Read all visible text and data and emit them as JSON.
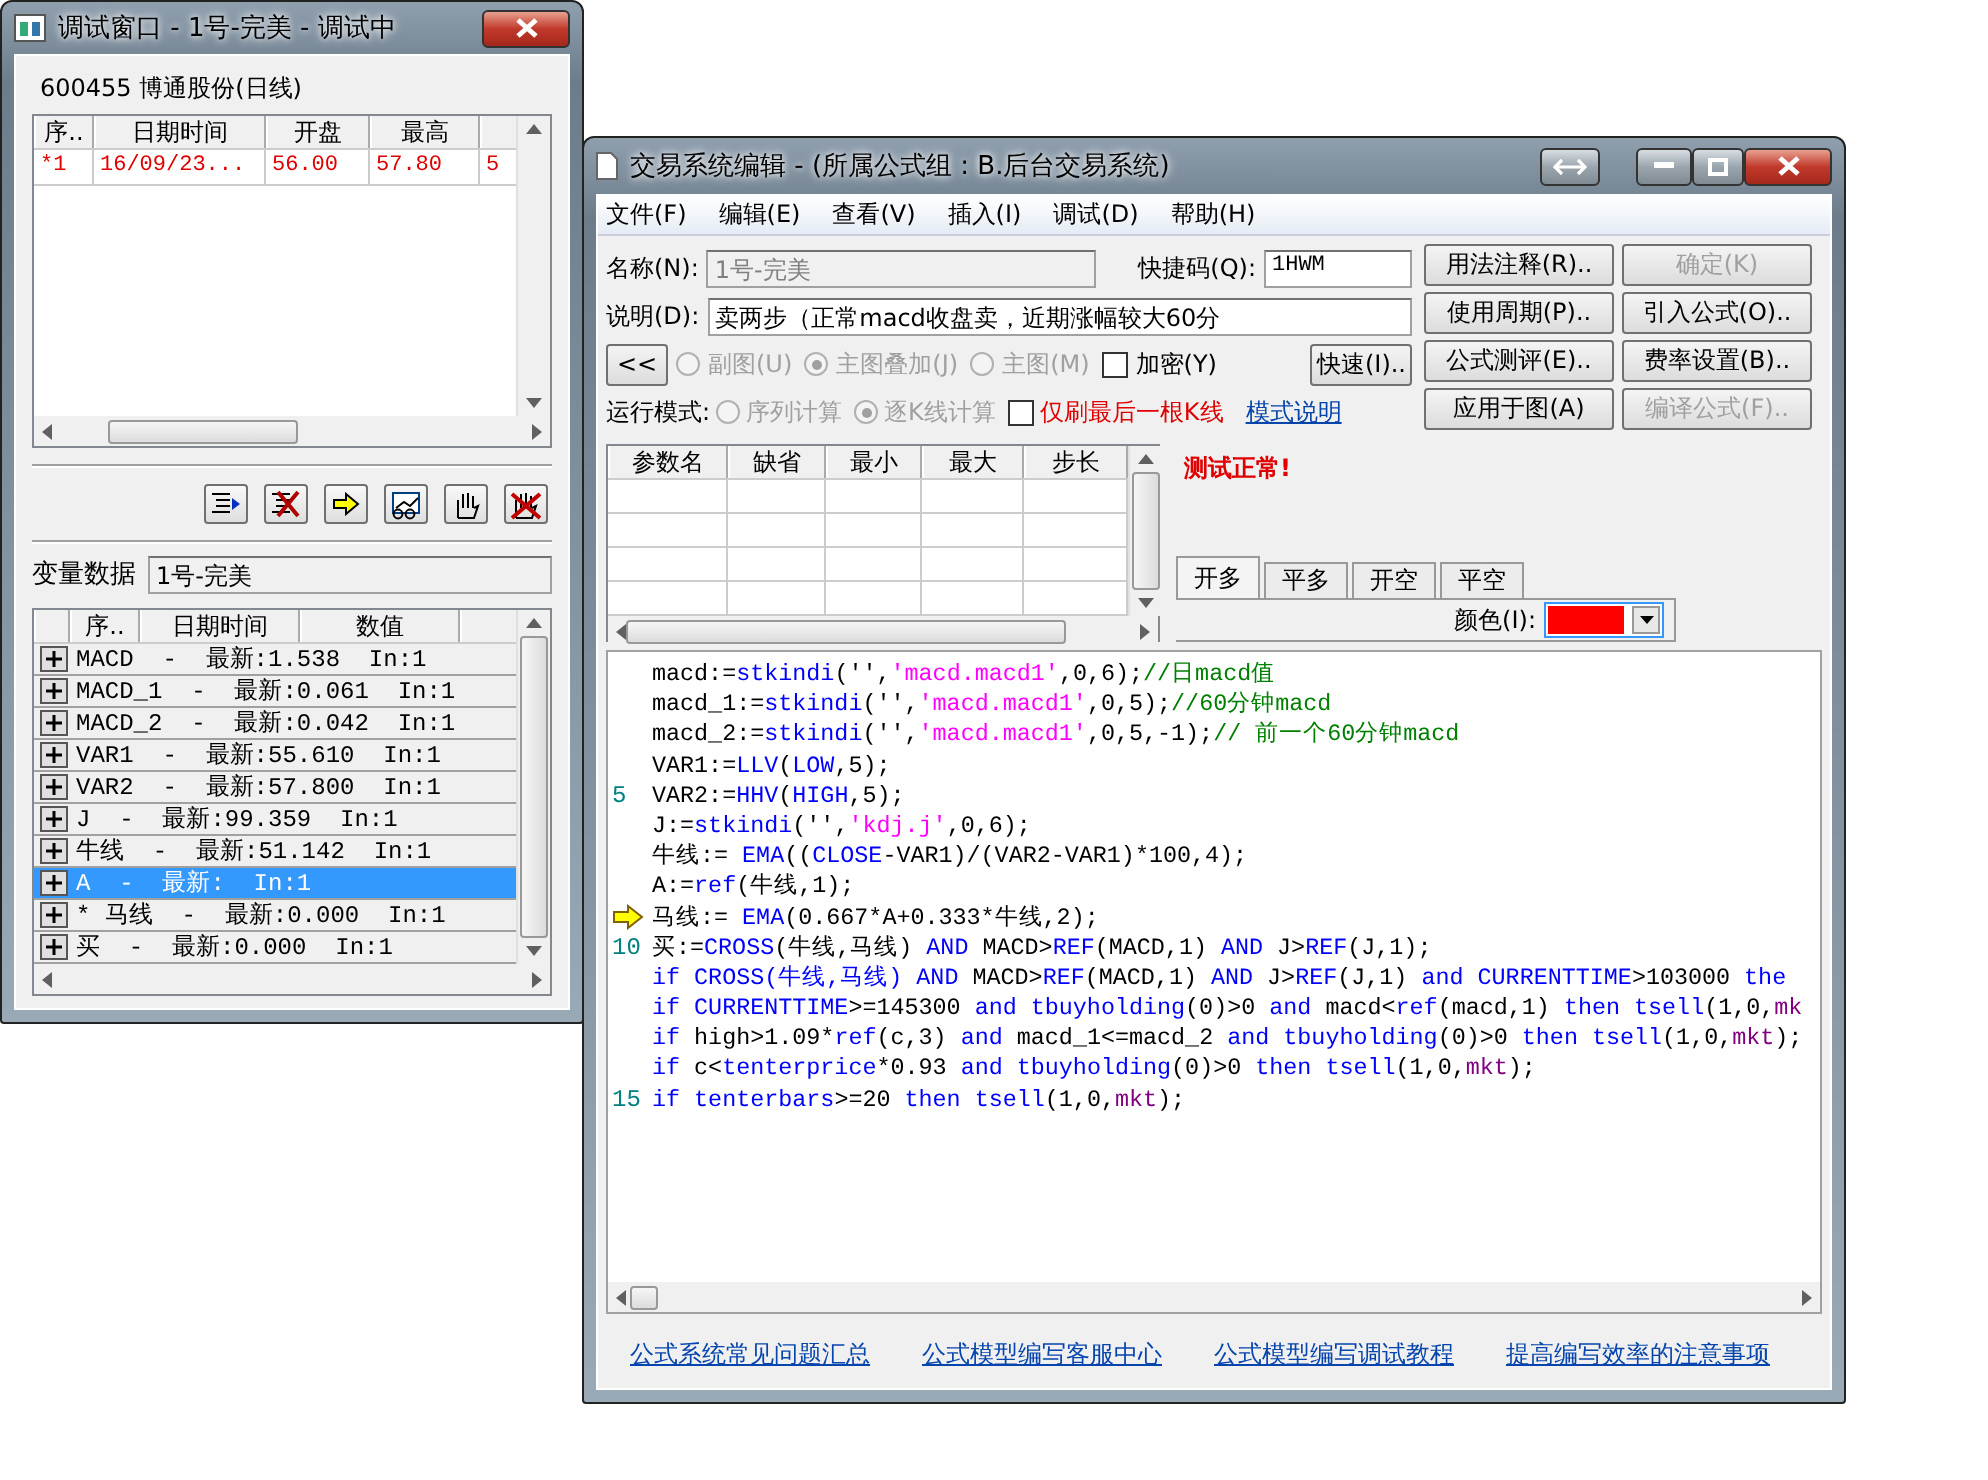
{
  "debug_window": {
    "title": "调试窗口 - 1号-完美 - 调试中",
    "stock": "600455 博通股份(日线)",
    "quote_table": {
      "columns": [
        "序..",
        "日期时间",
        "开盘",
        "最高"
      ],
      "rows": [
        {
          "cells": [
            "*1",
            "16/09/23...",
            "56.00",
            "57.80",
            "5"
          ]
        }
      ]
    },
    "variable_label": "变量数据",
    "variable_value": "1号-完美",
    "variable_table": {
      "columns": [
        "序..",
        "日期时间",
        "数值"
      ],
      "rows": [
        {
          "text": "MACD  -  最新:1.538  In:1",
          "selected": false
        },
        {
          "text": "MACD_1  -  最新:0.061  In:1",
          "selected": false
        },
        {
          "text": "MACD_2  -  最新:0.042  In:1",
          "selected": false
        },
        {
          "text": "VAR1  -  最新:55.610  In:1",
          "selected": false
        },
        {
          "text": "VAR2  -  最新:57.800  In:1",
          "selected": false
        },
        {
          "text": "J  -  最新:99.359  In:1",
          "selected": false
        },
        {
          "text": "牛线  -  最新:51.142  In:1",
          "selected": false
        },
        {
          "text": "A  -  最新:  In:1",
          "selected": true
        },
        {
          "text": "* 马线  -  最新:0.000  In:1",
          "selected": false
        },
        {
          "text": "买  -  最新:0.000  In:1",
          "selected": false
        }
      ]
    }
  },
  "editor_window": {
    "title": "交易系统编辑 - (所属公式组 : B.后台交易系统)",
    "menu": [
      "文件(F)",
      "编辑(E)",
      "查看(V)",
      "插入(I)",
      "调试(D)",
      "帮助(H)"
    ],
    "name": {
      "label": "名称(N):",
      "value": "1号-完美"
    },
    "shortcut": {
      "label": "快捷码(Q):",
      "value": "1HWM"
    },
    "description": {
      "label": "说明(D):",
      "value": "卖两步（正常macd收盘卖，近期涨幅较大60分"
    },
    "buttons": [
      {
        "label": "用法注释(R)..",
        "disabled": false
      },
      {
        "label": "确定(K)",
        "disabled": true
      },
      {
        "label": "使用周期(P)..",
        "disabled": false
      },
      {
        "label": "引入公式(O)..",
        "disabled": false
      },
      {
        "label": "公式测评(E)..",
        "disabled": false
      },
      {
        "label": "费率设置(B)..",
        "disabled": false
      },
      {
        "label": "应用于图(A)",
        "disabled": false
      },
      {
        "label": "编译公式(F)..",
        "disabled": true
      }
    ],
    "collapse_button": "<<",
    "chart_modes": [
      {
        "label": "副图(U)",
        "selected": false,
        "disabled": true
      },
      {
        "label": "主图叠加(J)",
        "selected": true,
        "disabled": true
      },
      {
        "label": "主图(M)",
        "selected": false,
        "disabled": true
      }
    ],
    "encrypt": {
      "label": "加密(Y)",
      "checked": false
    },
    "quick_button": "快速(I)..",
    "run_mode": {
      "label": "运行模式:",
      "options": [
        {
          "label": "序列计算",
          "selected": false,
          "disabled": true
        },
        {
          "label": "逐K线计算",
          "selected": true,
          "disabled": true
        }
      ]
    },
    "last_bar_only": {
      "label": "仅刷最后一根K线",
      "checked": false
    },
    "mode_link": "模式说明",
    "param_table": {
      "columns": [
        "参数名",
        "缺省",
        "最小",
        "最大",
        "步长"
      ]
    },
    "status": "测试正常!",
    "tabs": [
      {
        "label": "开多",
        "selected": true
      },
      {
        "label": "平多",
        "selected": false
      },
      {
        "label": "开空",
        "selected": false
      },
      {
        "label": "平空",
        "selected": false
      }
    ],
    "color": {
      "label": "颜色(I):",
      "color": "#ff0000"
    },
    "code_lines": [
      {
        "current": false,
        "segments": [
          {
            "kind": "text",
            "text": "macd:="
          },
          {
            "kind": "func",
            "text": "stkindi"
          },
          {
            "kind": "text",
            "text": "('',"
          },
          {
            "kind": "string",
            "text": "'macd.macd1'"
          },
          {
            "kind": "text",
            "text": ",0,6);"
          },
          {
            "kind": "comment",
            "text": "//日macd值"
          }
        ]
      },
      {
        "current": false,
        "segments": [
          {
            "kind": "text",
            "text": "macd_1:="
          },
          {
            "kind": "func",
            "text": "stkindi"
          },
          {
            "kind": "text",
            "text": "('',"
          },
          {
            "kind": "string",
            "text": "'macd.macd1'"
          },
          {
            "kind": "text",
            "text": ",0,5);"
          },
          {
            "kind": "comment",
            "text": "//60分钟macd"
          }
        ]
      },
      {
        "current": false,
        "segments": [
          {
            "kind": "text",
            "text": "macd_2:="
          },
          {
            "kind": "func",
            "text": "stkindi"
          },
          {
            "kind": "text",
            "text": "('',"
          },
          {
            "kind": "string",
            "text": "'macd.macd1'"
          },
          {
            "kind": "text",
            "text": ",0,5,-1);"
          },
          {
            "kind": "comment",
            "text": "// 前一个60分钟macd"
          }
        ]
      },
      {
        "current": false,
        "segments": [
          {
            "kind": "text",
            "text": "VAR1:="
          },
          {
            "kind": "func",
            "text": "LLV"
          },
          {
            "kind": "text",
            "text": "("
          },
          {
            "kind": "func",
            "text": "LOW"
          },
          {
            "kind": "text",
            "text": ",5);"
          }
        ]
      },
      {
        "number": "5",
        "current": false,
        "segments": [
          {
            "kind": "text",
            "text": "VAR2:="
          },
          {
            "kind": "func",
            "text": "HHV"
          },
          {
            "kind": "text",
            "text": "("
          },
          {
            "kind": "func",
            "text": "HIGH"
          },
          {
            "kind": "text",
            "text": ",5);"
          }
        ]
      },
      {
        "current": false,
        "segments": [
          {
            "kind": "text",
            "text": "J:="
          },
          {
            "kind": "func",
            "text": "stkindi"
          },
          {
            "kind": "text",
            "text": "('',"
          },
          {
            "kind": "string",
            "text": "'kdj.j'"
          },
          {
            "kind": "text",
            "text": ",0,6);"
          }
        ]
      },
      {
        "current": false,
        "segments": [
          {
            "kind": "text",
            "text": "牛线:= "
          },
          {
            "kind": "func",
            "text": "EMA"
          },
          {
            "kind": "text",
            "text": "(("
          },
          {
            "kind": "func",
            "text": "CLOSE"
          },
          {
            "kind": "text",
            "text": "-VAR1)/(VAR2-VAR1)*100,4);"
          }
        ]
      },
      {
        "current": false,
        "segments": [
          {
            "kind": "text",
            "text": "A:="
          },
          {
            "kind": "func",
            "text": "ref"
          },
          {
            "kind": "text",
            "text": "(牛线,1);"
          }
        ]
      },
      {
        "current": true,
        "segments": [
          {
            "kind": "text",
            "text": "马线:= "
          },
          {
            "kind": "func",
            "text": "EMA"
          },
          {
            "kind": "text",
            "text": "(0.667*A+0.333*牛线,2);"
          }
        ]
      },
      {
        "number": "10",
        "current": false,
        "segments": [
          {
            "kind": "text",
            "text": "买:="
          },
          {
            "kind": "func",
            "text": "CROSS"
          },
          {
            "kind": "text",
            "text": "(牛线,马线) "
          },
          {
            "kind": "func",
            "text": "AND"
          },
          {
            "kind": "text",
            "text": " MACD>"
          },
          {
            "kind": "func",
            "text": "REF"
          },
          {
            "kind": "text",
            "text": "(MACD,1) "
          },
          {
            "kind": "func",
            "text": "AND"
          },
          {
            "kind": "text",
            "text": " J>"
          },
          {
            "kind": "func",
            "text": "REF"
          },
          {
            "kind": "text",
            "text": "(J,1);"
          }
        ]
      },
      {
        "current": false,
        "segments": [
          {
            "kind": "func",
            "text": "if CROSS(牛线,马线) AND"
          },
          {
            "kind": "text",
            "text": " MACD>"
          },
          {
            "kind": "func",
            "text": "REF"
          },
          {
            "kind": "text",
            "text": "(MACD,1) "
          },
          {
            "kind": "func",
            "text": "AND"
          },
          {
            "kind": "text",
            "text": " J>"
          },
          {
            "kind": "func",
            "text": "REF"
          },
          {
            "kind": "text",
            "text": "(J,1) "
          },
          {
            "kind": "func",
            "text": "and CURRENTTIME"
          },
          {
            "kind": "text",
            "text": ">103000 "
          },
          {
            "kind": "func",
            "text": "the"
          }
        ]
      },
      {
        "current": false,
        "segments": [
          {
            "kind": "func",
            "text": "if CURRENTTIME"
          },
          {
            "kind": "text",
            "text": ">=145300 "
          },
          {
            "kind": "func",
            "text": "and tbuyholding"
          },
          {
            "kind": "text",
            "text": "(0)>0 "
          },
          {
            "kind": "func",
            "text": "and"
          },
          {
            "kind": "text",
            "text": " macd<"
          },
          {
            "kind": "func",
            "text": "ref"
          },
          {
            "kind": "text",
            "text": "(macd,1) "
          },
          {
            "kind": "func",
            "text": "then tsell"
          },
          {
            "kind": "text",
            "text": "(1,0,"
          },
          {
            "kind": "const",
            "text": "mk"
          }
        ]
      },
      {
        "current": false,
        "segments": [
          {
            "kind": "func",
            "text": "if"
          },
          {
            "kind": "text",
            "text": " high>1.09*"
          },
          {
            "kind": "func",
            "text": "ref"
          },
          {
            "kind": "text",
            "text": "(c,3) "
          },
          {
            "kind": "func",
            "text": "and"
          },
          {
            "kind": "text",
            "text": " macd_1<=macd_2 "
          },
          {
            "kind": "func",
            "text": "and tbuyholding"
          },
          {
            "kind": "text",
            "text": "(0)>0 "
          },
          {
            "kind": "func",
            "text": "then tsell"
          },
          {
            "kind": "text",
            "text": "(1,0,"
          },
          {
            "kind": "const",
            "text": "mkt"
          },
          {
            "kind": "text",
            "text": ");"
          }
        ]
      },
      {
        "current": false,
        "segments": [
          {
            "kind": "func",
            "text": "if"
          },
          {
            "kind": "text",
            "text": " c<"
          },
          {
            "kind": "func",
            "text": "tenterprice"
          },
          {
            "kind": "text",
            "text": "*0.93 "
          },
          {
            "kind": "func",
            "text": "and tbuyholding"
          },
          {
            "kind": "text",
            "text": "(0)>0 "
          },
          {
            "kind": "func",
            "text": "then tsell"
          },
          {
            "kind": "text",
            "text": "(1,0,"
          },
          {
            "kind": "const",
            "text": "mkt"
          },
          {
            "kind": "text",
            "text": ");"
          }
        ]
      },
      {
        "number": "15",
        "current": false,
        "segments": [
          {
            "kind": "func",
            "text": "if tenterbars"
          },
          {
            "kind": "text",
            "text": ">=20 "
          },
          {
            "kind": "func",
            "text": "then tsell"
          },
          {
            "kind": "text",
            "text": "(1,0,"
          },
          {
            "kind": "const",
            "text": "mkt"
          },
          {
            "kind": "text",
            "text": ");"
          }
        ]
      }
    ],
    "footer_links": [
      "公式系统常见问题汇总",
      "公式模型编写客服中心",
      "公式模型编写调试教程",
      "提高编写效率的注意事项"
    ]
  }
}
